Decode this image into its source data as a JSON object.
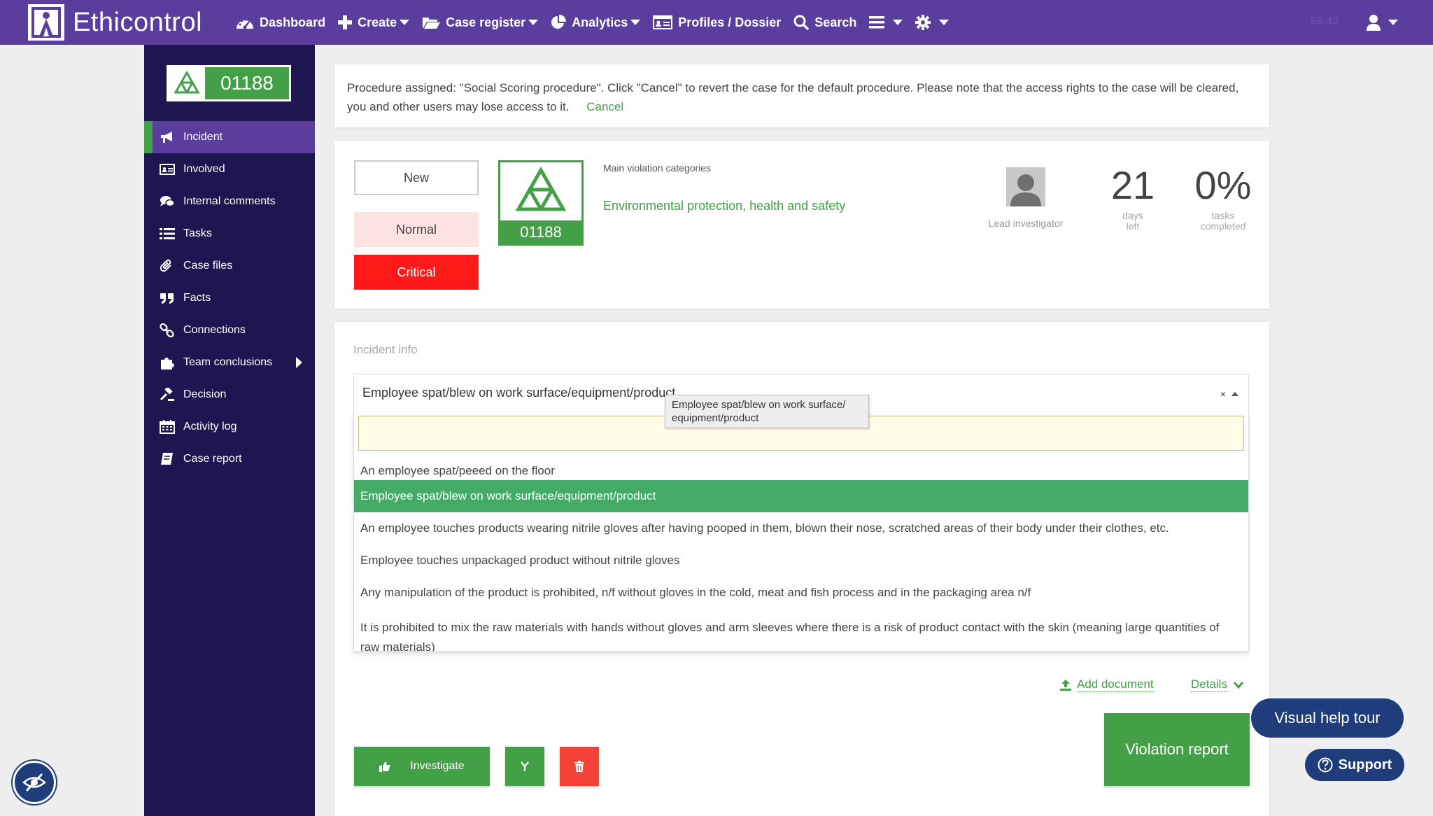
{
  "app": {
    "title": "Ethicontrol"
  },
  "nav": {
    "items": [
      {
        "label": "Dashboard",
        "icon": "dashboard-icon"
      },
      {
        "label": "Create",
        "icon": "plus-icon"
      },
      {
        "label": "Case register",
        "icon": "folder-icon"
      },
      {
        "label": "Analytics",
        "icon": "pie-chart-icon"
      },
      {
        "label": "Profiles / Dossier",
        "icon": "id-card-icon"
      },
      {
        "label": "Search",
        "icon": "search-icon"
      }
    ],
    "timer": "59:43"
  },
  "sidebar": {
    "case_number": "01188",
    "items": [
      {
        "label": "Incident",
        "icon": "megaphone-icon",
        "active": true
      },
      {
        "label": "Involved",
        "icon": "id-card-icon"
      },
      {
        "label": "Internal comments",
        "icon": "comments-icon"
      },
      {
        "label": "Tasks",
        "icon": "list-icon"
      },
      {
        "label": "Case files",
        "icon": "paperclip-icon"
      },
      {
        "label": "Facts",
        "icon": "quote-icon"
      },
      {
        "label": "Connections",
        "icon": "link-icon"
      },
      {
        "label": "Team conclusions",
        "icon": "puzzle-icon"
      },
      {
        "label": "Decision",
        "icon": "gavel-icon"
      },
      {
        "label": "Activity log",
        "icon": "calendar-icon"
      },
      {
        "label": "Case report",
        "icon": "book-icon"
      }
    ]
  },
  "notice": {
    "text": "Procedure assigned: \"Social Scoring procedure\". Click \"Cancel\" to revert the case for the default procedure. Please note that the access rights to the case will be cleared, you and other users may lose access to it.",
    "cancel_label": "Cancel"
  },
  "summary": {
    "status_new": "New",
    "priority_normal": "Normal",
    "priority_critical": "Critical",
    "case_number": "01188",
    "violation_label": "Main violation categories",
    "violation_value": "Environmental protection, health and safety",
    "investigator_label": "Lead investigator",
    "days_left_value": "21",
    "days_left_label_1": "days",
    "days_left_label_2": "left",
    "tasks_value": "0%",
    "tasks_label_1": "tasks",
    "tasks_label_2": "completed"
  },
  "incident": {
    "label": "Incident info",
    "selected_value": "Employee spat/blew on work surface/equipment/product",
    "tooltip": "Employee spat/blew on work surface/ equipment/product",
    "search_placeholder": "",
    "options": [
      "An employee spat/peeed on the floor",
      "Employee spat/blew on work surface/equipment/product",
      "An employee touches products wearing nitrile gloves after having pooped in them, blown their nose, scratched areas of their body under their clothes, etc.",
      "Employee touches unpackaged product without nitrile gloves",
      "Any manipulation of the product is prohibited, n/f without gloves in the cold, meat and fish process and in the packaging area n/f",
      "It is prohibited to mix the raw materials with hands without gloves and arm sleeves where there is a risk of product contact with the skin (meaning large quantities of raw materials)"
    ],
    "selected_index": 1
  },
  "actions": {
    "add_document": "Add document",
    "details": "Details",
    "investigate": "Investigate",
    "violation_report": "Violation report"
  },
  "help": {
    "visual_tour": "Visual help tour",
    "support": "Support"
  },
  "colors": {
    "navbar": "#5b3d9e",
    "sidebar": "#1e1650",
    "accent_green": "#43a047",
    "critical": "#ff1a1a",
    "help_blue": "#1f3d7a"
  }
}
